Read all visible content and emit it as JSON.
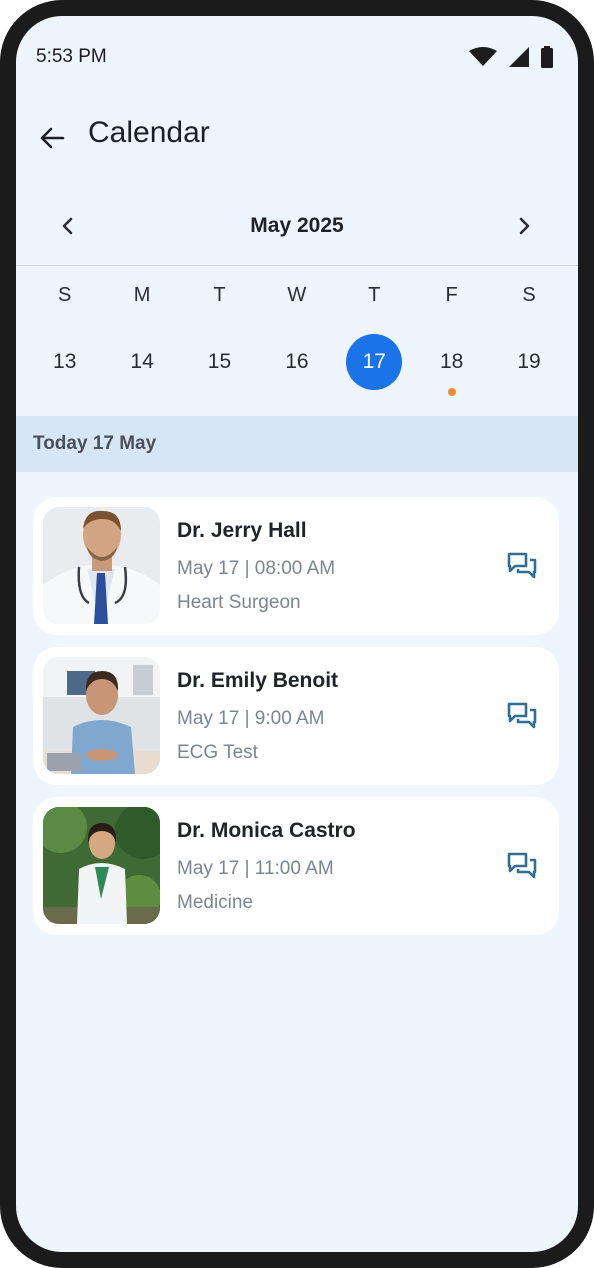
{
  "status_bar": {
    "time": "5:53 PM"
  },
  "header": {
    "title": "Calendar"
  },
  "calendar": {
    "month_label": "May 2025",
    "weekdays": [
      "S",
      "M",
      "T",
      "W",
      "T",
      "F",
      "S"
    ],
    "days": [
      "13",
      "14",
      "15",
      "16",
      "17",
      "18",
      "19"
    ],
    "selected_day": "17",
    "event_dot_day": "18",
    "accent_color": "#1a73e8",
    "dot_color": "#f28a2e"
  },
  "today_label": "Today 17 May",
  "appointments": [
    {
      "name": "Dr. Jerry Hall",
      "time": "May 17 | 08:00 AM",
      "specialty": "Heart Surgeon",
      "icon": "chat-icon"
    },
    {
      "name": "Dr. Emily Benoit",
      "time": "May 17 | 9:00 AM",
      "specialty": "ECG Test",
      "icon": "chat-icon"
    },
    {
      "name": "Dr. Monica Castro",
      "time": "May 17 | 11:00 AM",
      "specialty": "Medicine",
      "icon": "chat-icon"
    }
  ]
}
